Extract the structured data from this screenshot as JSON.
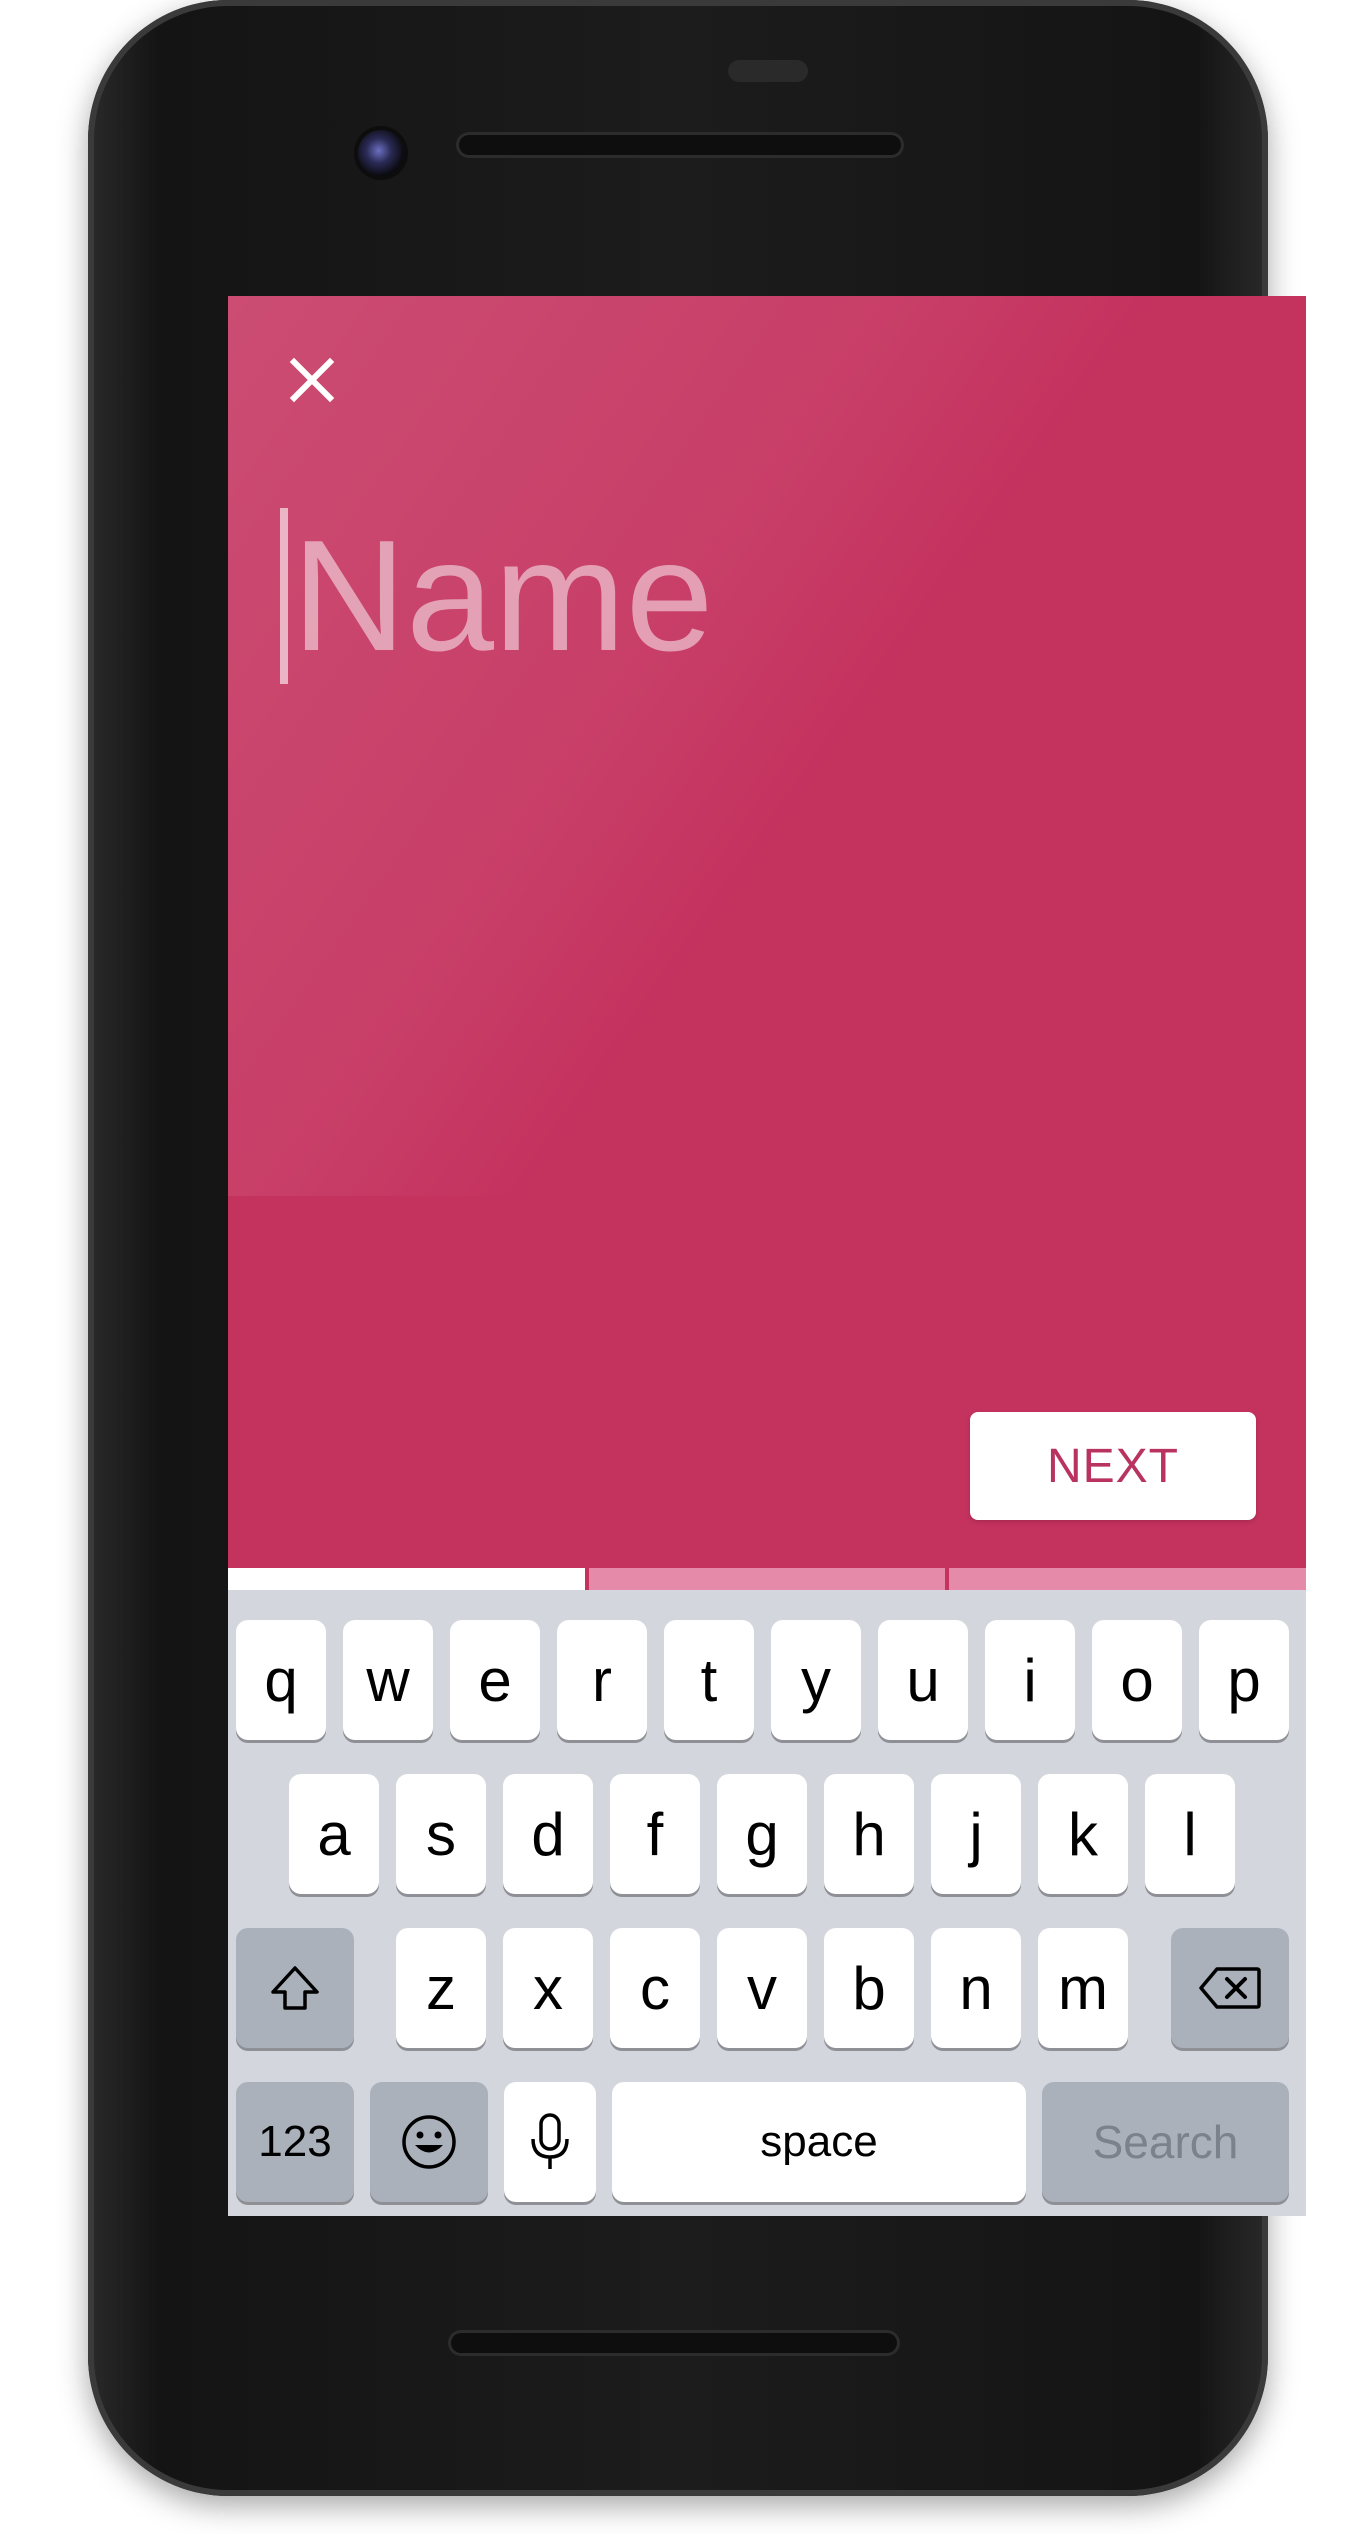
{
  "form": {
    "name_placeholder": "Name",
    "name_value": "",
    "next_label": "NEXT",
    "close_icon": "close-icon"
  },
  "colors": {
    "screen_background": "#c4325e",
    "next_text": "#b8335f",
    "progress_active": "#ffffff",
    "progress_inactive": "#e58aa8",
    "keyboard_background": "#d3d6dc"
  },
  "progress": {
    "steps_total": 3,
    "current_step": 1
  },
  "keyboard": {
    "row1": [
      "q",
      "w",
      "e",
      "r",
      "t",
      "y",
      "u",
      "i",
      "o",
      "p"
    ],
    "row2": [
      "a",
      "s",
      "d",
      "f",
      "g",
      "h",
      "j",
      "k",
      "l"
    ],
    "row3": [
      "z",
      "x",
      "c",
      "v",
      "b",
      "n",
      "m"
    ],
    "shift_icon": "shift-icon",
    "backspace_icon": "backspace-icon",
    "numbers_label": "123",
    "emoji_icon": "emoji-icon",
    "mic_icon": "microphone-icon",
    "space_label": "space",
    "search_label": "Search"
  }
}
